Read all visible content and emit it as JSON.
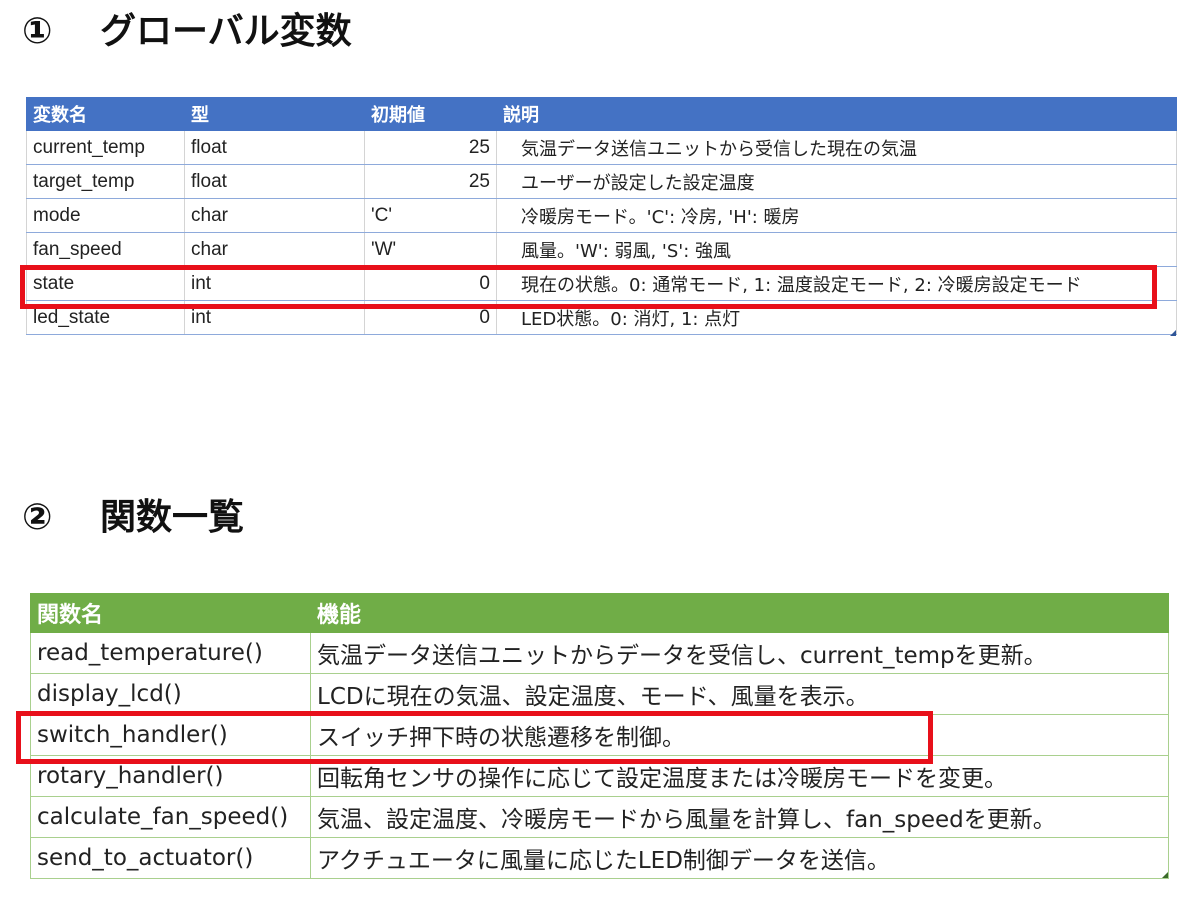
{
  "section1": {
    "number": "①",
    "title": "グローバル変数",
    "headers": [
      "変数名",
      "型",
      "初期値",
      "説明"
    ],
    "rows": [
      {
        "name": "current_temp",
        "type": "float",
        "init": "25",
        "desc": "気温データ送信ユニットから受信した現在の気温"
      },
      {
        "name": "target_temp",
        "type": "float",
        "init": "25",
        "desc": "ユーザーが設定した設定温度"
      },
      {
        "name": "mode",
        "type": "char",
        "init": "'C'",
        "desc": "冷暖房モード。'C': 冷房, 'H': 暖房"
      },
      {
        "name": "fan_speed",
        "type": "char",
        "init": "'W'",
        "desc": "風量。'W': 弱風, 'S': 強風"
      },
      {
        "name": "state",
        "type": "int",
        "init": "0",
        "desc": "現在の状態。0: 通常モード, 1: 温度設定モード, 2: 冷暖房設定モード"
      },
      {
        "name": "led_state",
        "type": "int",
        "init": "0",
        "desc": "LED状態。0: 消灯, 1: 点灯"
      }
    ]
  },
  "section2": {
    "number": "②",
    "title": "関数一覧",
    "headers": [
      "関数名",
      "機能"
    ],
    "rows": [
      {
        "name": "read_temperature()",
        "desc": "気温データ送信ユニットからデータを受信し、current_tempを更新。"
      },
      {
        "name": "display_lcd()",
        "desc": "LCDに現在の気温、設定温度、モード、風量を表示。"
      },
      {
        "name": "switch_handler()",
        "desc": "スイッチ押下時の状態遷移を制御。"
      },
      {
        "name": "rotary_handler()",
        "desc": "回転角センサの操作に応じて設定温度または冷暖房モードを変更。"
      },
      {
        "name": "calculate_fan_speed()",
        "desc": "気温、設定温度、冷暖房モードから風量を計算し、fan_speedを更新。"
      },
      {
        "name": "send_to_actuator()",
        "desc": "アクチュエータに風量に応じたLED制御データを送信。"
      }
    ]
  },
  "colors": {
    "table1_header": "#4472c4",
    "table2_header": "#70ad47",
    "highlight": "#e8101a"
  }
}
